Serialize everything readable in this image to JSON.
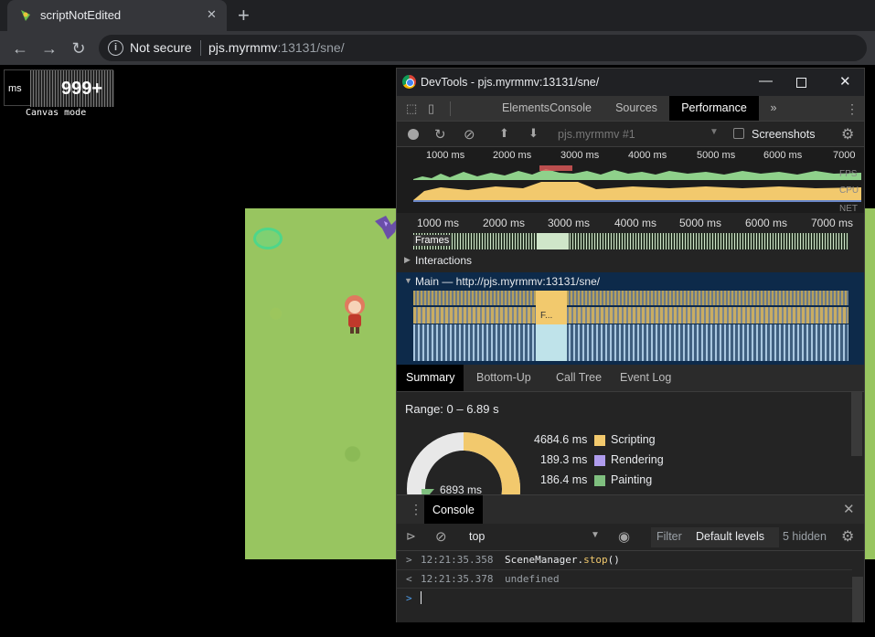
{
  "browser": {
    "tab_title": "scriptNotEdited",
    "new_tab": "+",
    "security_label": "Not secure",
    "url_host": "pjs.myrmmv",
    "url_rest": ":13131/sne/"
  },
  "game": {
    "fps_unit": "ms",
    "fps_value": "999+",
    "mode_label": "Canvas mode"
  },
  "devtools": {
    "window_title": "DevTools - pjs.myrmmv:13131/sne/",
    "tabs": [
      "Elements",
      "Console",
      "Sources",
      "Performance"
    ],
    "active_tab": "Performance",
    "more_tabs": "»",
    "profile_select": "pjs.myrmmv #1",
    "screenshots_label": "Screenshots",
    "overview_ticks": [
      "1000 ms",
      "2000 ms",
      "3000 ms",
      "4000 ms",
      "5000 ms",
      "6000 ms",
      "7000 m"
    ],
    "overview_labels": [
      "FPS",
      "CPU",
      "NET"
    ],
    "timeline_ticks": [
      "1000 ms",
      "2000 ms",
      "3000 ms",
      "4000 ms",
      "5000 ms",
      "6000 ms",
      "7000 ms"
    ],
    "frames_label": "Frames",
    "interactions_label": "Interactions",
    "main_label": "Main — http://pjs.myrmmv:13131/sne/",
    "flame_label": "F...",
    "summary_tabs": [
      "Summary",
      "Bottom-Up",
      "Call Tree",
      "Event Log"
    ],
    "range": "Range: 0 – 6.89 s",
    "total": "6893 ms",
    "legend": [
      {
        "value": "4684.6 ms",
        "label": "Scripting",
        "color": "#f2c96d"
      },
      {
        "value": "189.3 ms",
        "label": "Rendering",
        "color": "#af9ced"
      },
      {
        "value": "186.4 ms",
        "label": "Painting",
        "color": "#7fbf7f"
      }
    ],
    "console": {
      "tab_label": "Console",
      "context": "top",
      "filter_placeholder": "Filter",
      "levels": "Default levels",
      "hidden": "5 hidden",
      "lines": [
        {
          "arrow": ">",
          "time": "12:21:35.358",
          "text_obj": "SceneManager",
          "text_dot": ".",
          "text_fn": "stop",
          "text_paren": "()"
        },
        {
          "arrow": "<",
          "time": "12:21:35.378",
          "text": "undefined"
        }
      ],
      "prompt": ">"
    }
  }
}
